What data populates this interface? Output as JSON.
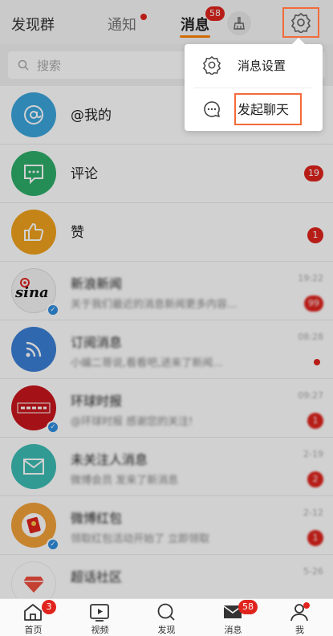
{
  "topbar": {
    "discover_group": "发现群",
    "tab_notify": "通知",
    "tab_messages": "消息",
    "messages_badge": "58"
  },
  "search": {
    "placeholder": "搜索"
  },
  "popup": {
    "settings_label": "消息设置",
    "start_chat_label": "发起聊天"
  },
  "rows": [
    {
      "title": "@我的"
    },
    {
      "title": "评论",
      "badge": "19"
    },
    {
      "title": "赞",
      "badge": "1"
    },
    {
      "title": "新浪新闻",
      "subtitle": "关于我们最近的消息新闻更多内容...",
      "time": "19:22",
      "badge": "99"
    },
    {
      "title": "订阅消息",
      "subtitle": "小编二哥说,看看吧,进来了新闻...",
      "time": "08:28"
    },
    {
      "title": "环球时报",
      "subtitle": "@环球时报 感谢您的关注!",
      "time": "09:27",
      "badge": "1"
    },
    {
      "title": "未关注人消息",
      "subtitle": "微博会员 发来了新消息",
      "time": "2-19",
      "badge": "2"
    },
    {
      "title": "微博红包",
      "subtitle": "领取红包活动开始了 立即领取",
      "time": "2-12",
      "badge": "1"
    },
    {
      "title": "超话社区",
      "subtitle": "",
      "time": "5-26"
    }
  ],
  "avatars": {
    "row4_logo": "sina"
  },
  "bottomnav": {
    "home": "首页",
    "home_badge": "3",
    "video": "视频",
    "discover": "发现",
    "messages": "消息",
    "messages_badge": "58",
    "me": "我"
  },
  "colors": {
    "accent": "#ff8200",
    "badge_red": "#e0241d",
    "highlight_box": "#f26b3a"
  }
}
